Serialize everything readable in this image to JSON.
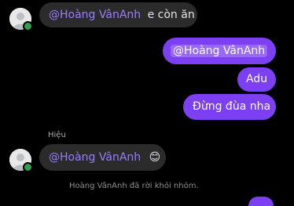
{
  "messages": {
    "m1": {
      "mention": "@Hoàng VânAnh",
      "text": "e còn ăn"
    },
    "m2": {
      "mention": "@Hoàng VânAnh"
    },
    "m3": {
      "text": "Adu"
    },
    "m4": {
      "text": "Đừng đùa nha"
    },
    "sender_name": "Hiệu",
    "m5": {
      "mention": "@Hoàng VânAnh",
      "emoji": "😊"
    }
  },
  "system_notice": "Hoàng VânAnh đã rời khỏi nhóm.",
  "icons": {
    "avatar": "default-profile-avatar",
    "online": "online-status-dot"
  },
  "colors": {
    "outgoing_bubble": "#7c3ff2",
    "incoming_bubble": "#2b2b2b",
    "mention_incoming": "#9b7cff",
    "online_dot": "#31a24c"
  }
}
